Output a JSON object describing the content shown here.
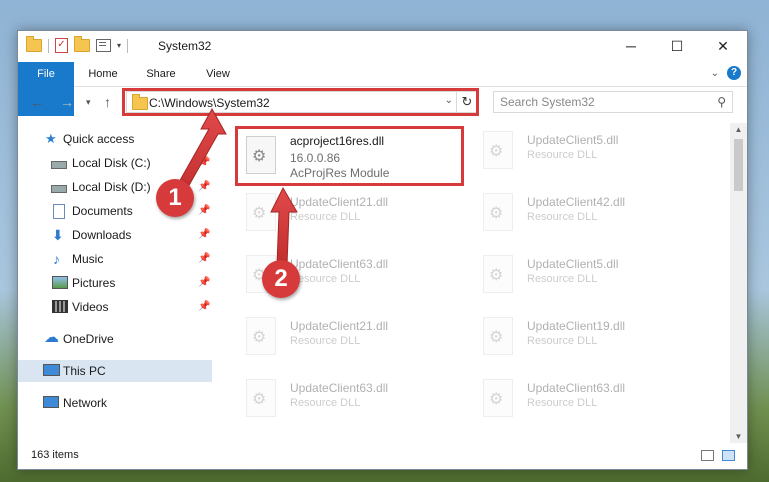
{
  "window": {
    "title": "System32"
  },
  "ribbon": {
    "tabs": [
      "File",
      "Home",
      "Share",
      "View"
    ],
    "help": "?"
  },
  "address": {
    "path": "C:\\Windows\\System32",
    "refresh": "↻",
    "dropdown": "⌄"
  },
  "search": {
    "placeholder": "Search System32"
  },
  "sidebar": {
    "items": [
      {
        "label": "Quick access",
        "icon": "star-icon"
      },
      {
        "label": "Local Disk (C:)",
        "icon": "drive-icon",
        "pinned": true
      },
      {
        "label": "Local Disk (D:)",
        "icon": "drive-icon",
        "pinned": true
      },
      {
        "label": "Documents",
        "icon": "document-icon",
        "pinned": true
      },
      {
        "label": "Downloads",
        "icon": "download-icon",
        "pinned": true
      },
      {
        "label": "Music",
        "icon": "music-icon",
        "pinned": true
      },
      {
        "label": "Pictures",
        "icon": "pictures-icon",
        "pinned": true
      },
      {
        "label": "Videos",
        "icon": "video-icon",
        "pinned": true
      },
      {
        "label": "OneDrive",
        "icon": "cloud-icon"
      },
      {
        "label": "This PC",
        "icon": "computer-icon",
        "selected": true
      },
      {
        "label": "Network",
        "icon": "network-icon"
      }
    ]
  },
  "files": {
    "highlighted": {
      "name": "acproject16res.dll",
      "version": "16.0.0.86",
      "description": "AcProjRes Module"
    },
    "col1": [
      {
        "name": "UpdateClient21.dll",
        "type": "Resource DLL"
      },
      {
        "name": "UpdateClient63.dll",
        "type": "Resource DLL"
      },
      {
        "name": "UpdateClient21.dll",
        "type": "Resource DLL"
      },
      {
        "name": "UpdateClient63.dll",
        "type": "Resource DLL"
      }
    ],
    "col2": [
      {
        "name": "UpdateClient5.dll",
        "type": "Resource DLL"
      },
      {
        "name": "UpdateClient42.dll",
        "type": "Resource DLL"
      },
      {
        "name": "UpdateClient5.dll",
        "type": "Resource DLL"
      },
      {
        "name": "UpdateClient19.dll",
        "type": "Resource DLL"
      },
      {
        "name": "UpdateClient63.dll",
        "type": "Resource DLL"
      }
    ]
  },
  "status": {
    "count": "163 items"
  },
  "callouts": {
    "one": "1",
    "two": "2"
  },
  "colors": {
    "accent": "#1979ca",
    "annotation": "#d63a3a"
  }
}
